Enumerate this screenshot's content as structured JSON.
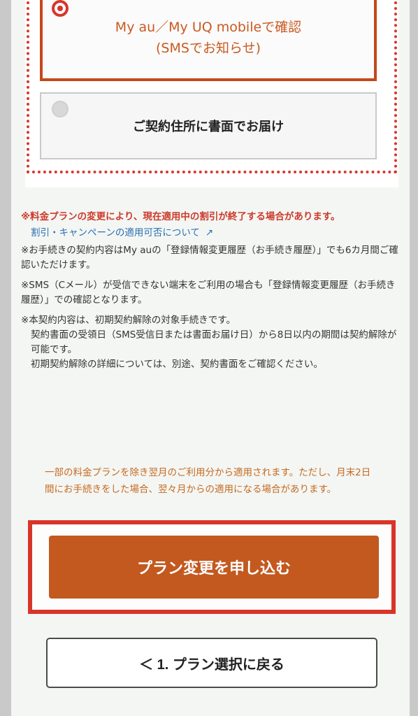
{
  "delivery": {
    "sms_option": {
      "line1": "My au／My UQ mobileで確認",
      "line2": "(SMSでお知らせ)"
    },
    "mail_option": {
      "label": "ご契約住所に書面でお届け"
    }
  },
  "notes": {
    "warning": "※料金プランの変更により、現在適用中の割引が終了する場合があります。",
    "link": "割引・キャンペーンの適用可否について",
    "link_icon": "external-link-icon",
    "item1": "※お手続きの契約内容はMy auの「登録情報変更履歴（お手続き履歴）」でも6カ月間ご確認いただけます。",
    "item2": "※SMS（Cメール）が受信できない端末をご利用の場合も「登録情報変更履歴（お手続き履歴）」での確認となります。",
    "item3_line1": "※本契約内容は、初期契約解除の対象手続きです。",
    "item3_line2": "契約書面の受領日（SMS受信日または書面お届け日）から8日以内の期間は契約解除が可能です。",
    "item3_line3": "初期契約解除の詳細については、別途、契約書面をご確認ください。"
  },
  "timing_note": "一部の料金プランを除き翌月のご利用分から適用されます。ただし、月末2日間にお手続きをした場合、翌々月からの適用になる場合があります。",
  "buttons": {
    "apply": "プラン変更を申し込む",
    "back": "＜ 1. プラン選択に戻る"
  },
  "colors": {
    "accent_red": "#d8352a",
    "button_orange": "#c3591f",
    "link_blue": "#2b6fb3",
    "note_orange": "#c46a22"
  }
}
